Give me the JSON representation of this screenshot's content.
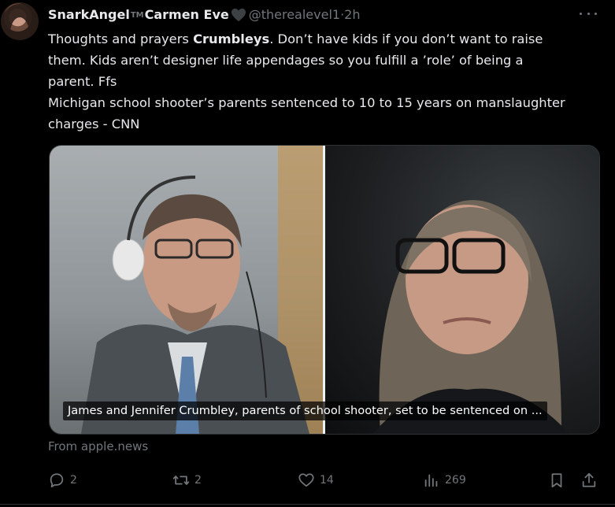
{
  "tweet": {
    "display_name": "SnarkAngel",
    "tm_mark": "TM",
    "display_name_2": "Carmen Eve",
    "handle": "@therealevel1",
    "separator": " · ",
    "time": "2h",
    "text_lines": [
      {
        "pre": "Thoughts and prayers ",
        "bold": "Crumbleys",
        "post": ". Don’t have kids if you don’t want to raise"
      },
      {
        "pre": "them. Kids aren’t designer life appendages so you fulfill a ’role’ of being a",
        "bold": "",
        "post": ""
      },
      {
        "pre": "parent. Ffs",
        "bold": "",
        "post": ""
      },
      {
        "pre": "Michigan school shooter’s parents sentenced to 10 to 15 years on manslaughter",
        "bold": "",
        "post": ""
      },
      {
        "pre": "charges - CNN",
        "bold": "",
        "post": ""
      }
    ],
    "media_caption": "James and Jennifer Crumbley, parents of school shooter, set to be sentenced on ...",
    "source": "From apple.news"
  },
  "actions": {
    "replies": "2",
    "reposts": "2",
    "likes": "14",
    "views": "269"
  },
  "colors": {
    "background": "#000000",
    "text": "#e7e9ea",
    "muted": "#71767b",
    "border": "#2f3336"
  }
}
